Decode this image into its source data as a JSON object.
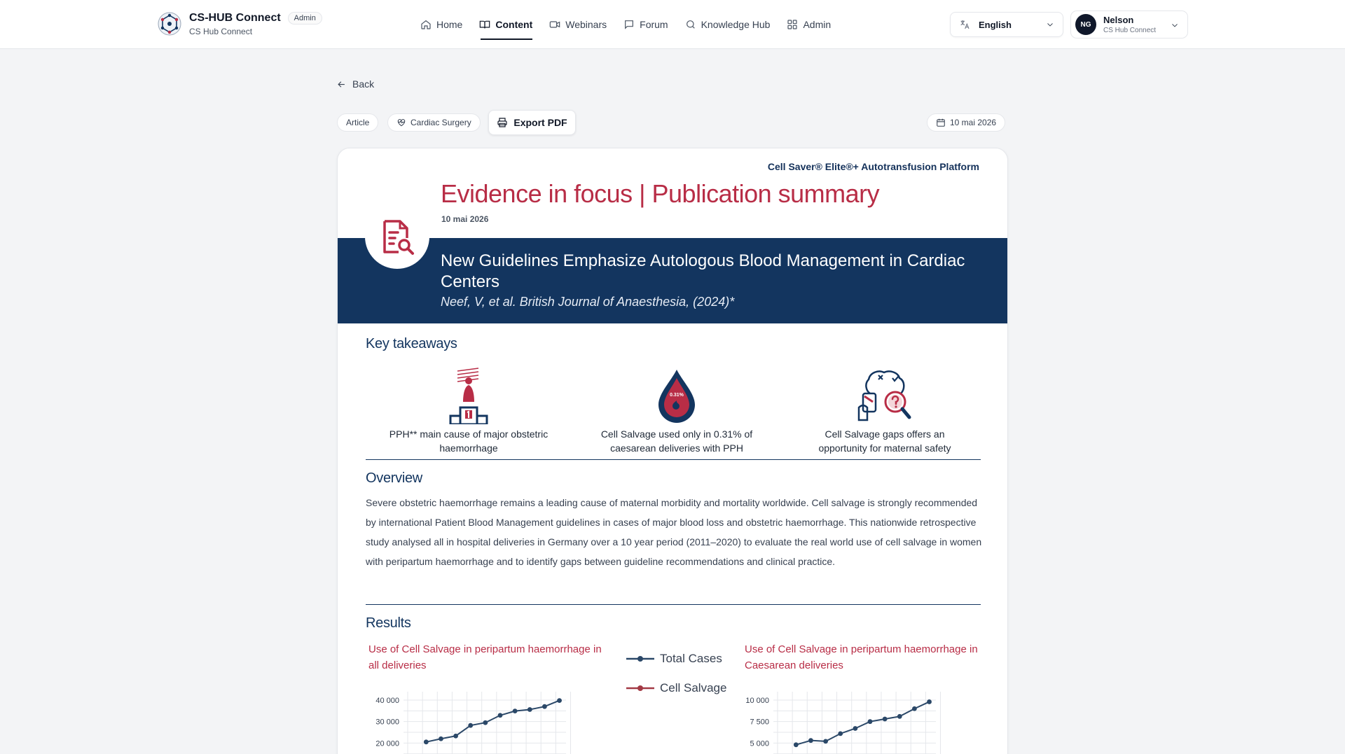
{
  "app": {
    "title": "CS-HUB Connect",
    "badge": "Admin",
    "subtitle": "CS Hub Connect"
  },
  "nav": {
    "items": [
      {
        "label": "Home",
        "icon": "home-icon",
        "active": false
      },
      {
        "label": "Content",
        "icon": "book-icon",
        "active": true
      },
      {
        "label": "Webinars",
        "icon": "video-icon",
        "active": false
      },
      {
        "label": "Forum",
        "icon": "chat-icon",
        "active": false
      },
      {
        "label": "Knowledge Hub",
        "icon": "search-icon",
        "active": false
      },
      {
        "label": "Admin",
        "icon": "grid-icon",
        "active": false
      }
    ]
  },
  "language": {
    "selected": "English"
  },
  "user": {
    "initials": "NG",
    "name": "Nelson",
    "org": "CS Hub Connect"
  },
  "toolbar": {
    "back_label": "Back",
    "type_chip": "Article",
    "category_chip": "Cardiac Surgery",
    "export_label": "Export PDF",
    "date_chip": "10 mai 2026"
  },
  "article": {
    "platform": "Cell Saver® Elite®+ Autotransfusion Platform",
    "headline": "Evidence in focus | Publication summary",
    "date": "10 mai 2026",
    "title": "New Guidelines Emphasize Autologous Blood Management in Cardiac Centers",
    "citation": "Neef, V, et al. British Journal of Anaesthesia, (2024)*",
    "takeaways_heading": "Key takeaways",
    "takeaways": [
      {
        "text": "PPH** main cause of major obstetric haemorrhage",
        "icon": "podium-first-place-icon"
      },
      {
        "text": "Cell Salvage used only in 0.31% of caesarean deliveries with PPH",
        "icon": "blood-drop-icon",
        "drop_label": "0.31%"
      },
      {
        "text": "Cell Salvage gaps offers an opportunity for maternal safety",
        "icon": "brain-question-icon"
      }
    ],
    "overview_heading": "Overview",
    "overview": "Severe obstetric haemorrhage remains a leading cause of maternal morbidity and mortality worldwide. Cell salvage is strongly recommended by international Patient Blood Management guidelines in cases of major blood loss and obstetric haemorrhage. This nationwide retrospective study analysed all in hospital deliveries in Germany over a 10 year period (2011–2020) to evaluate the real world use of cell salvage in women with peripartum haemorrhage and to identify gaps between guideline recommendations and clinical practice.",
    "results_heading": "Results"
  },
  "colors": {
    "brand_red": "#b82d46",
    "navy": "#13355f",
    "total_series": "#2b4868",
    "salvage_series": "#a33a45"
  },
  "chart_data": [
    {
      "type": "line",
      "title": "Use of Cell Salvage in peripartum haemorrhage in all deliveries",
      "ytick_labels": [
        "20 000",
        "30 000",
        "40 000"
      ],
      "series": [
        {
          "name": "Total Cases",
          "values": [
            20500,
            22000,
            23300,
            28200,
            29500,
            32900,
            34900,
            35600,
            37000,
            39800
          ]
        }
      ],
      "legend": [
        "Total Cases",
        "Cell Salvage"
      ]
    },
    {
      "type": "line",
      "title": "Use of Cell Salvage in peripartum haemorrhage in Caesarean deliveries",
      "ytick_labels": [
        "5 000",
        "7 500",
        "10 000"
      ],
      "series": [
        {
          "name": "Total Cases",
          "values": [
            4800,
            5300,
            5200,
            6100,
            6700,
            7500,
            7800,
            8100,
            9000,
            9800
          ]
        }
      ]
    }
  ]
}
